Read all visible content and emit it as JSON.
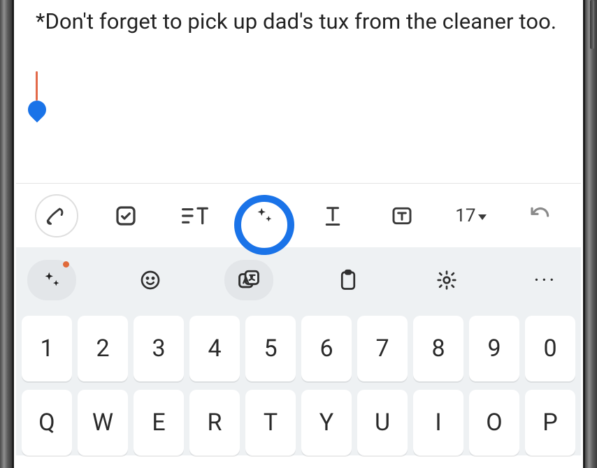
{
  "note": {
    "text": "*Don't forget to pick up dad's tux from the cleaner too."
  },
  "toolbar": {
    "font_size_label": "17",
    "icons": {
      "pen": "pen",
      "checkbox": "checkbox",
      "textformat": "text-format",
      "sparkle": "ai-sparkle",
      "underline": "underline",
      "textbox": "text-box",
      "undo": "undo"
    }
  },
  "kb_actions": {
    "ai": "ai-sparkle",
    "emoji": "emoji",
    "translate": "translate",
    "clipboard": "clipboard",
    "settings": "settings",
    "more": "···"
  },
  "kb_rows": {
    "numbers": [
      "1",
      "2",
      "3",
      "4",
      "5",
      "6",
      "7",
      "8",
      "9",
      "0"
    ],
    "row1": [
      "Q",
      "W",
      "E",
      "R",
      "T",
      "Y",
      "U",
      "I",
      "O",
      "P"
    ]
  }
}
